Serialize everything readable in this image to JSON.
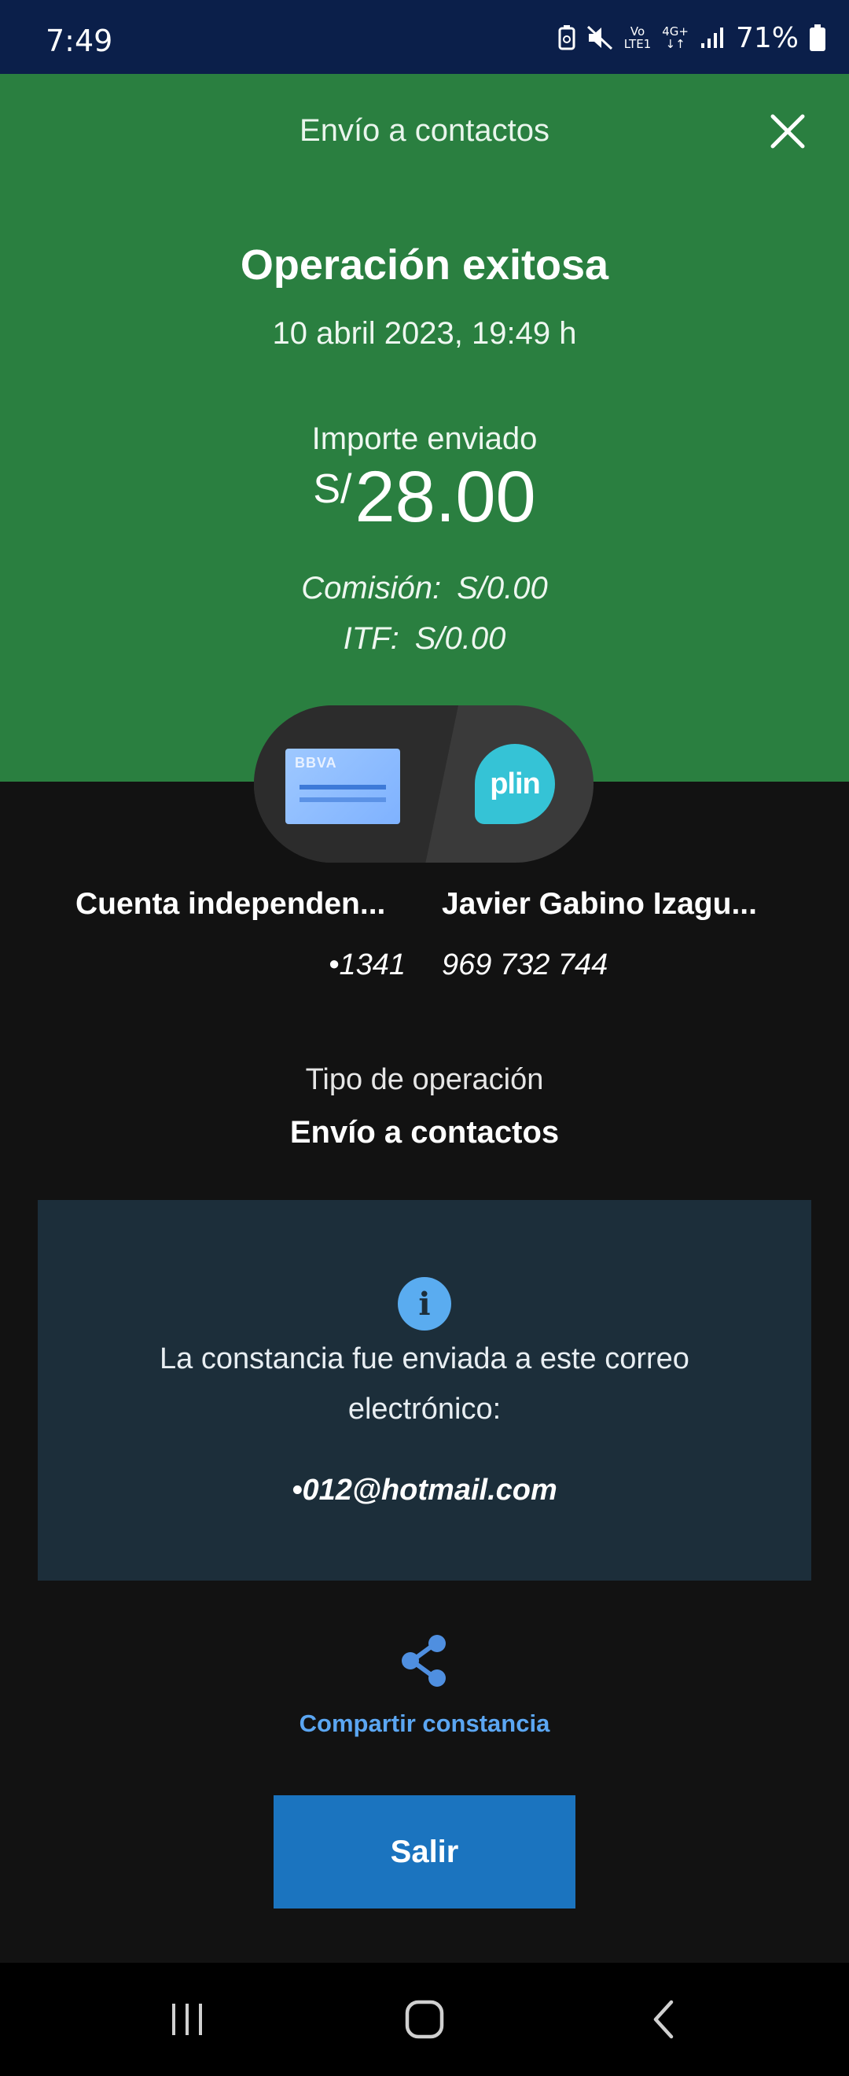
{
  "status_bar": {
    "time": "7:49",
    "net_top": "Vo",
    "net_bottom": "LTE1",
    "net_type": "4G+",
    "battery": "71%"
  },
  "header": {
    "title": "Envío a contactos",
    "close_icon": "close-icon"
  },
  "summary": {
    "status": "Operación exitosa",
    "datetime": "10 abril 2023, 19:49 h",
    "amount_label": "Importe enviado",
    "currency": "S/",
    "amount": "28.00",
    "commission_label": "Comisión:",
    "commission_value": "S/0.00",
    "itf_label": "ITF:",
    "itf_value": "S/0.00"
  },
  "route": {
    "source_brand": "BBVA",
    "dest_brand": "plin"
  },
  "source": {
    "name": "Cuenta independen...",
    "account": "•1341"
  },
  "destination": {
    "name": "Javier Gabino Izagu...",
    "phone": "969 732 744"
  },
  "operation": {
    "type_label": "Tipo de operación",
    "type_value": "Envío a contactos"
  },
  "notice": {
    "icon": "info-icon",
    "text": "La constancia fue enviada a este correo electrónico:",
    "email": "•012@hotmail.com"
  },
  "actions": {
    "share_icon": "share-icon",
    "share_label": "Compartir constancia",
    "exit_label": "Salir"
  },
  "colors": {
    "header_green": "#2a7f40",
    "background": "#121212",
    "info_box": "#1c2e3a",
    "accent_blue": "#1b74bf",
    "link_blue": "#5ba6f2",
    "status_bar": "#0b1f4a"
  }
}
